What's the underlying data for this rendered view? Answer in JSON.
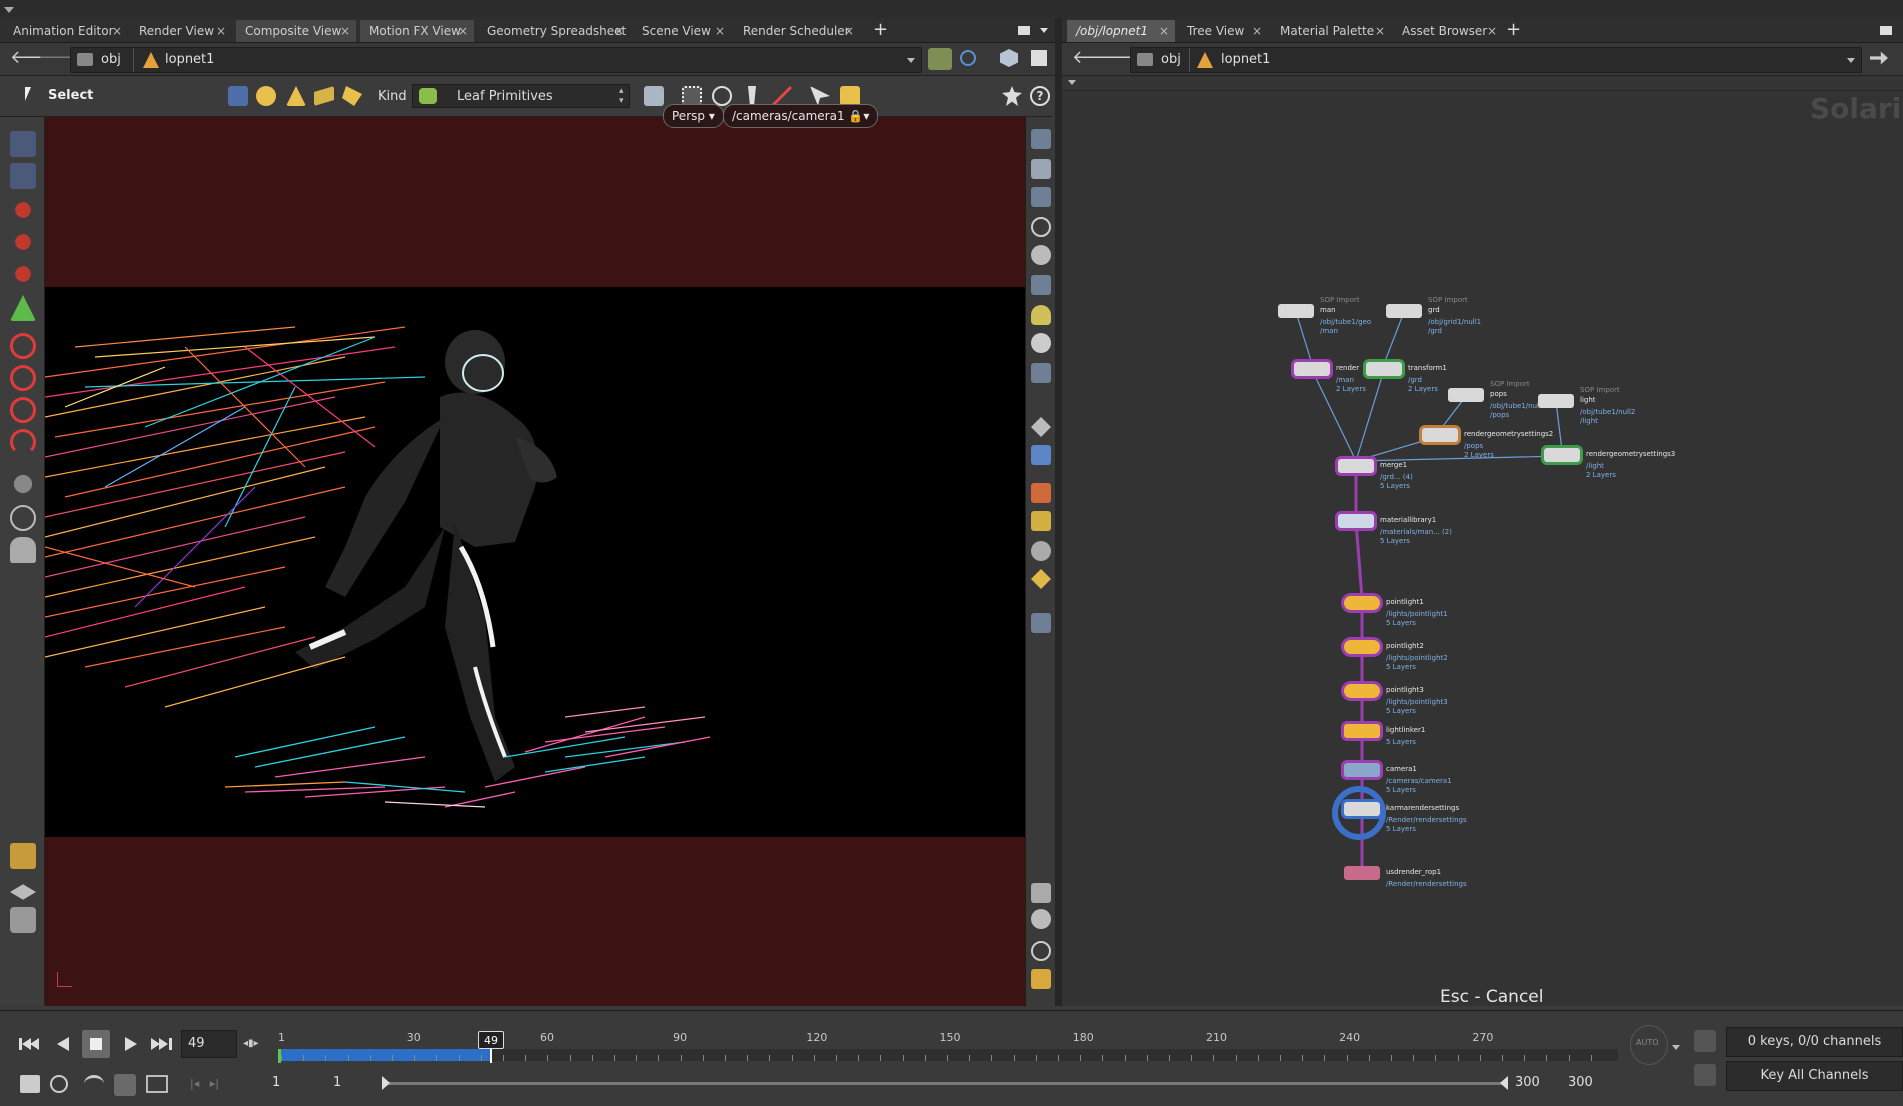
{
  "left_tabs": [
    {
      "label": "Animation Editor",
      "state": "normal"
    },
    {
      "label": "Render View",
      "state": "normal"
    },
    {
      "label": "Composite View",
      "state": "active"
    },
    {
      "label": "Motion FX View",
      "state": "active"
    },
    {
      "label": "Geometry Spreadsheet",
      "state": "normal"
    },
    {
      "label": "Scene View",
      "state": "normal"
    },
    {
      "label": "Render Scheduler",
      "state": "normal"
    }
  ],
  "right_tabs": [
    {
      "label": "/obj/lopnet1",
      "state": "active"
    },
    {
      "label": "Tree View",
      "state": "normal"
    },
    {
      "label": "Material Palette",
      "state": "normal"
    },
    {
      "label": "Asset Browser",
      "state": "normal"
    }
  ],
  "left_path": {
    "root": "obj",
    "node": "lopnet1"
  },
  "right_path": {
    "root": "obj",
    "node": "lopnet1"
  },
  "toolbar": {
    "select_label": "Select",
    "kind_label": "Kind",
    "kind_value": "Leaf Primitives"
  },
  "viewport": {
    "projection": "Persp",
    "camera": "/cameras/camera1"
  },
  "network": {
    "watermark": "Solaris",
    "status": "Esc - Cancel",
    "nodes": [
      {
        "name": "man",
        "type": "SOP Import",
        "sub": "/obj/tube1/geo\n/man"
      },
      {
        "name": "grd",
        "type": "SOP Import",
        "sub": "/obj/grid1/null1\n/grd"
      },
      {
        "name": "render",
        "type": "",
        "sub": "/man\n2 Layers"
      },
      {
        "name": "transform1",
        "type": "",
        "sub": "/grd\n2 Layers"
      },
      {
        "name": "pops",
        "type": "SOP Import",
        "sub": "/obj/tube1/null1\n/pops"
      },
      {
        "name": "light",
        "type": "SOP Import",
        "sub": "/obj/tube1/null2\n/light"
      },
      {
        "name": "rendergeometrysettings2",
        "type": "",
        "sub": "/pops\n2 Layers"
      },
      {
        "name": "rendergeometrysettings3",
        "type": "",
        "sub": "/light\n2 Layers"
      },
      {
        "name": "merge1",
        "type": "",
        "sub": "/grd... (4)\n5 Layers"
      },
      {
        "name": "materiallibrary1",
        "type": "",
        "sub": "/materials/man... (2)\n5 Layers"
      },
      {
        "name": "pointlight1",
        "type": "",
        "sub": "/lights/pointlight1\n5 Layers"
      },
      {
        "name": "pointlight2",
        "type": "",
        "sub": "/lights/pointlight2\n5 Layers"
      },
      {
        "name": "pointlight3",
        "type": "",
        "sub": "/lights/pointlight3\n5 Layers"
      },
      {
        "name": "lightlinker1",
        "type": "",
        "sub": "5 Layers"
      },
      {
        "name": "camera1",
        "type": "",
        "sub": "/cameras/camera1\n5 Layers"
      },
      {
        "name": "karmarendersettings",
        "type": "",
        "sub": "/Render/rendersettings\n5 Layers"
      },
      {
        "name": "usdrender_rop1",
        "type": "",
        "sub": "/Render/rendersettings"
      }
    ]
  },
  "timeline": {
    "current_frame": "49",
    "ticks": [
      "1",
      "30",
      "60",
      "90",
      "120",
      "150",
      "180",
      "210",
      "240",
      "270"
    ],
    "range_start": "1",
    "range_start2": "1",
    "range_end": "300",
    "range_end2": "300",
    "keys_label": "0 keys, 0/0 channels",
    "key_all_label": "Key All Channels",
    "auto_label": "AUTO"
  },
  "colors": {
    "viewport_bg": "#3d1212",
    "timeline_fill": "#2d6fc6",
    "node_outline": "#9b3fb0",
    "wire": "#6a9fd6"
  }
}
